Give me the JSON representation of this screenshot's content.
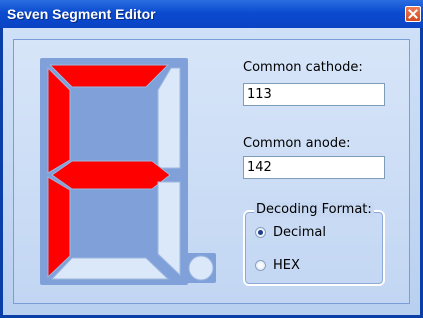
{
  "window": {
    "title": "Seven Segment Editor"
  },
  "fields": {
    "cathode_label": "Common cathode:",
    "cathode_value": "113",
    "anode_label": "Common anode:",
    "anode_value": "142"
  },
  "decoding": {
    "label": "Decoding Format:",
    "options": [
      "Decimal",
      "HEX"
    ],
    "selected": "Decimal"
  },
  "segments": {
    "a": true,
    "b": false,
    "c": false,
    "d": false,
    "e": true,
    "f": true,
    "g": true,
    "dp": false
  },
  "colors": {
    "segment_on": "#ff0000",
    "segment_off": "#dbe8f9",
    "segment_edge": "#9cb8e0",
    "display_bg": "#7fa0d8"
  }
}
